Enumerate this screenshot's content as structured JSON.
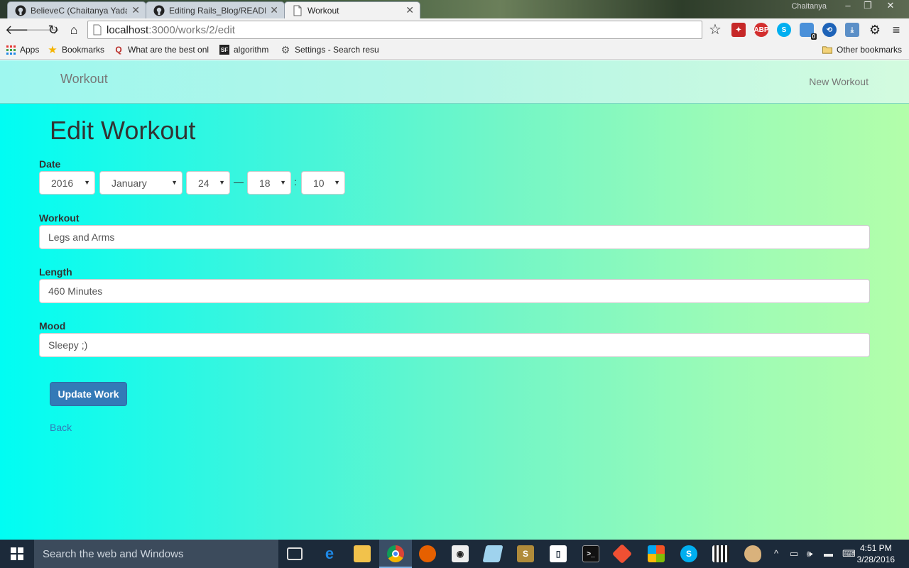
{
  "browser": {
    "tabs": [
      {
        "title": "BelieveC (Chaitanya Yadav",
        "icon": "github-icon"
      },
      {
        "title": "Editing Rails_Blog/READM",
        "icon": "github-icon"
      },
      {
        "title": "Workout",
        "icon": "page-icon"
      }
    ],
    "user": "Chaitanya",
    "url_host": "localhost",
    "url_path": ":3000/works/2/edit",
    "bookmarks": [
      {
        "label": "Apps",
        "icon": "apps-grid-icon"
      },
      {
        "label": "Bookmarks",
        "icon": "star-icon"
      },
      {
        "label": "What are the best onl",
        "icon": "quora-icon"
      },
      {
        "label": "algorithm",
        "icon": "sf-icon"
      },
      {
        "label": "Settings - Search resu",
        "icon": "gear-icon"
      }
    ],
    "other_bookmarks": "Other bookmarks",
    "extension_badge": "0"
  },
  "navbar": {
    "brand": "Workout",
    "new_link": "New Workout"
  },
  "form": {
    "title": "Edit Workout",
    "date_label": "Date",
    "year": "2016",
    "month": "January",
    "day": "24",
    "hour": "18",
    "minute": "10",
    "dash": "—",
    "colon": ":",
    "workout_label": "Workout",
    "workout_value": "Legs and Arms",
    "length_label": "Length",
    "length_value": "460 Minutes",
    "mood_label": "Mood",
    "mood_value": "Sleepy ;)",
    "submit": "Update Work",
    "back": "Back"
  },
  "taskbar": {
    "search_placeholder": "Search the web and Windows",
    "time": "4:51 PM",
    "date": "3/28/2016"
  },
  "colors": {
    "primary": "#337ab7",
    "page_gradient_start": "#00fdf3",
    "page_gradient_end": "#b3feaa"
  }
}
